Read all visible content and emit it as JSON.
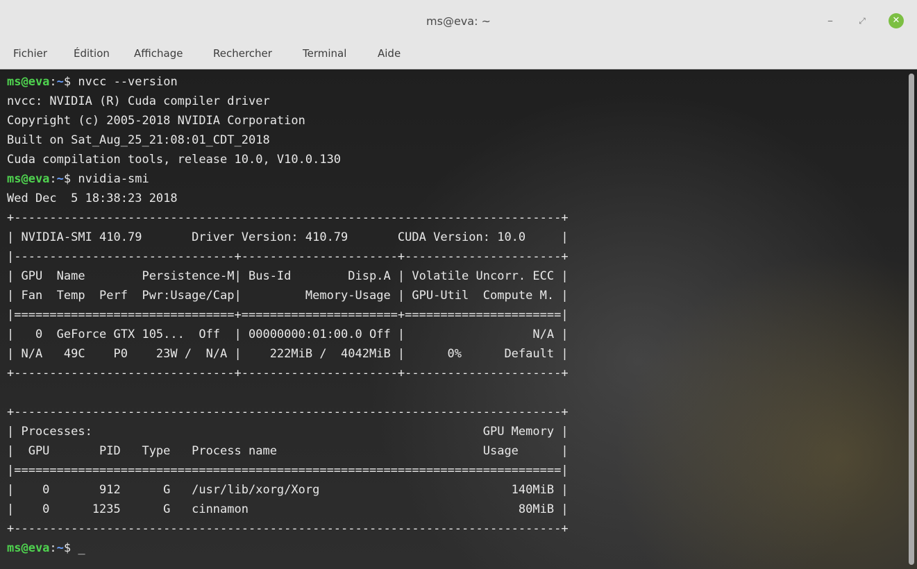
{
  "window": {
    "title": "ms@eva: ~",
    "minimize_symbol": "–",
    "maximize_symbol": "⤢",
    "close_symbol": "✕"
  },
  "menubar": {
    "items": [
      "Fichier",
      "Édition",
      "Affichage",
      "Rechercher",
      "Terminal",
      "Aide"
    ]
  },
  "prompt": {
    "user_host": "ms@eva",
    "separator": ":",
    "path": "~",
    "symbol": "$ "
  },
  "terminal": {
    "command1": "nvcc --version",
    "out1": [
      "nvcc: NVIDIA (R) Cuda compiler driver",
      "Copyright (c) 2005-2018 NVIDIA Corporation",
      "Built on Sat_Aug_25_21:08:01_CDT_2018",
      "Cuda compilation tools, release 10.0, V10.0.130"
    ],
    "command2": "nvidia-smi",
    "out2": [
      "Wed Dec  5 18:38:23 2018",
      "+-----------------------------------------------------------------------------+",
      "| NVIDIA-SMI 410.79       Driver Version: 410.79       CUDA Version: 10.0     |",
      "|-------------------------------+----------------------+----------------------+",
      "| GPU  Name        Persistence-M| Bus-Id        Disp.A | Volatile Uncorr. ECC |",
      "| Fan  Temp  Perf  Pwr:Usage/Cap|         Memory-Usage | GPU-Util  Compute M. |",
      "|===============================+======================+======================|",
      "|   0  GeForce GTX 105...  Off  | 00000000:01:00.0 Off |                  N/A |",
      "| N/A   49C    P0    23W /  N/A |    222MiB /  4042MiB |      0%      Default |",
      "+-------------------------------+----------------------+----------------------+",
      "",
      "+-----------------------------------------------------------------------------+",
      "| Processes:                                                       GPU Memory |",
      "|  GPU       PID   Type   Process name                             Usage      |",
      "|=============================================================================|",
      "|    0       912      G   /usr/lib/xorg/Xorg                           140MiB |",
      "|    0      1235      G   cinnamon                                      80MiB |",
      "+-----------------------------------------------------------------------------+"
    ],
    "cursor": "_"
  }
}
